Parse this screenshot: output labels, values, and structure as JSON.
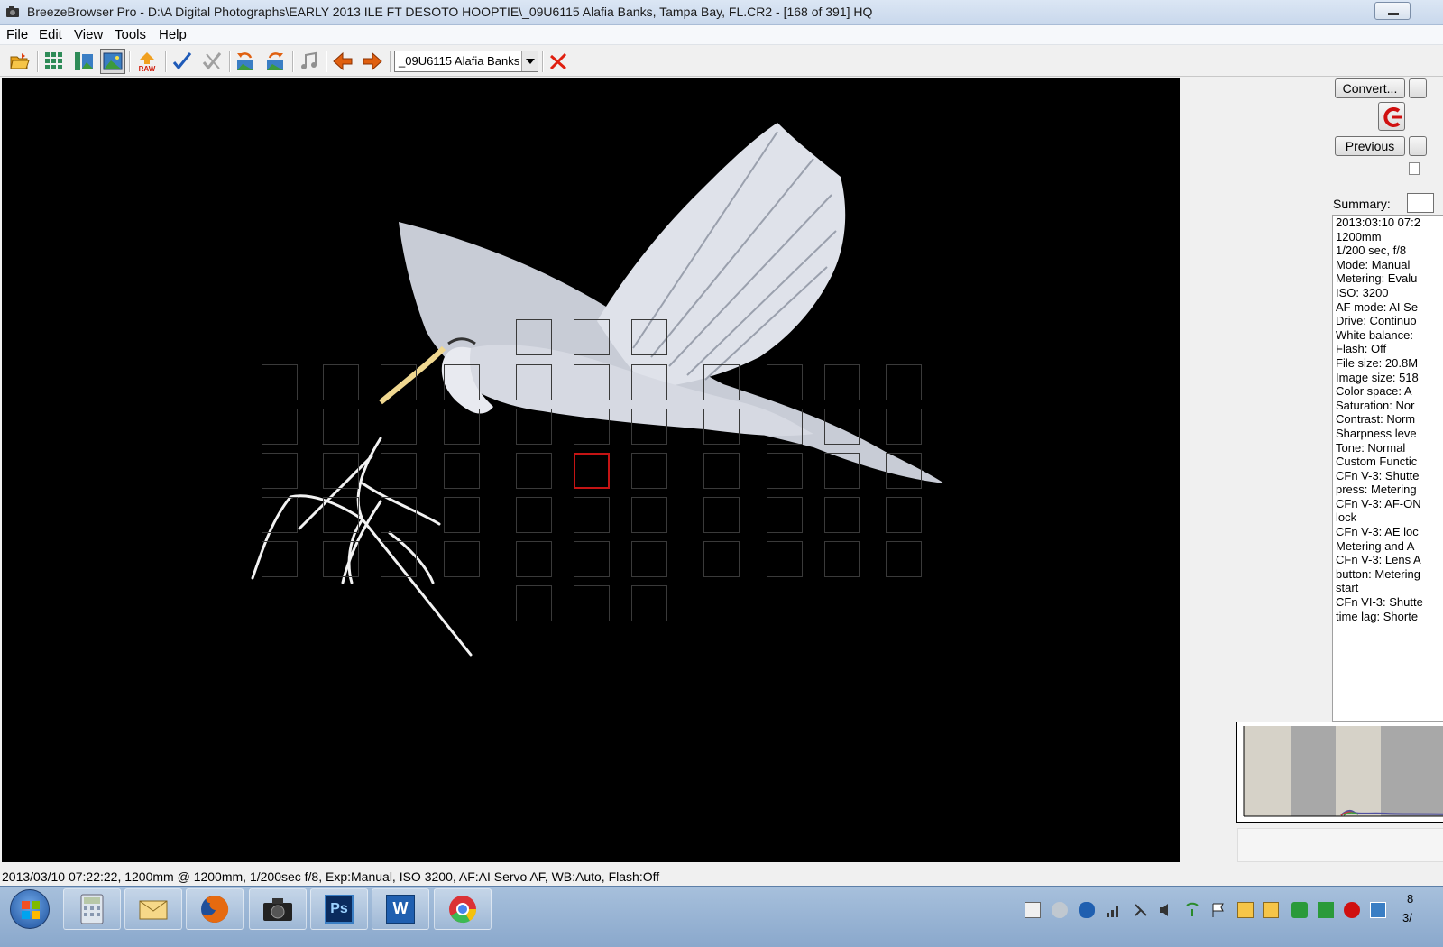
{
  "window": {
    "title": "BreezeBrowser Pro - D:\\A Digital Photographs\\EARLY 2013 ILE FT DESOTO HOOPTIE\\_09U6115  Alafia Banks, Tampa Bay, FL.CR2 - [168 of 391] HQ",
    "app_icon": "camera-icon"
  },
  "menu": [
    "File",
    "Edit",
    "View",
    "Tools",
    "Help"
  ],
  "toolbar": {
    "file_select_value": "_09U6115  Alafia Banks",
    "buttons": [
      "open-folder-icon",
      "thumbnail-grid-icon",
      "thumbnail-preview-icon",
      "single-image-icon",
      "raw-icon",
      "check-icon",
      "untag-icon",
      "rotate-left-icon",
      "rotate-right-icon",
      "music-icon",
      "previous-arrow-icon",
      "next-arrow-icon",
      "close-x-icon"
    ],
    "raw_label": "RAW"
  },
  "right_panel": {
    "convert_label": "Convert...",
    "previous_label": "Previous",
    "summary_label": "Summary:",
    "summary_lines": [
      "2013:03:10 07:2",
      "1200mm",
      "1/200 sec, f/8",
      "Mode: Manual",
      "Metering: Evalu",
      "ISO: 3200",
      "AF mode: AI Se",
      "Drive: Continuo",
      "White balance:",
      "Flash: Off",
      "File size: 20.8M",
      "Image size: 518",
      "Color space: A",
      "Saturation: Nor",
      "Contrast: Norm",
      "Sharpness leve",
      "Tone: Normal",
      "Custom Functic",
      "CFn V-3: Shutte",
      "press: Metering",
      "CFn V-3: AF-ON",
      "lock",
      "CFn V-3: AE loc",
      "Metering and A",
      "CFn V-3: Lens A",
      "button: Metering",
      "start",
      "CFn VI-3: Shutte",
      "time lag: Shorte"
    ]
  },
  "status": "2013/03/10 07:22:22, 1200mm @ 1200mm, 1/200sec f/8, Exp:Manual, ISO 3200, AF:AI Servo AF, WB:Auto, Flash:Off",
  "taskbar": {
    "apps": [
      "calculator-icon",
      "mail-icon",
      "firefox-icon",
      "camera-app-icon",
      "photoshop-icon",
      "word-icon",
      "chrome-icon"
    ],
    "photoshop_label": "Ps",
    "word_label": "W",
    "clock_time": "8",
    "clock_date": "3/"
  },
  "colors": {
    "af_selected": "#c41414",
    "viewer_bg": "#000000"
  }
}
